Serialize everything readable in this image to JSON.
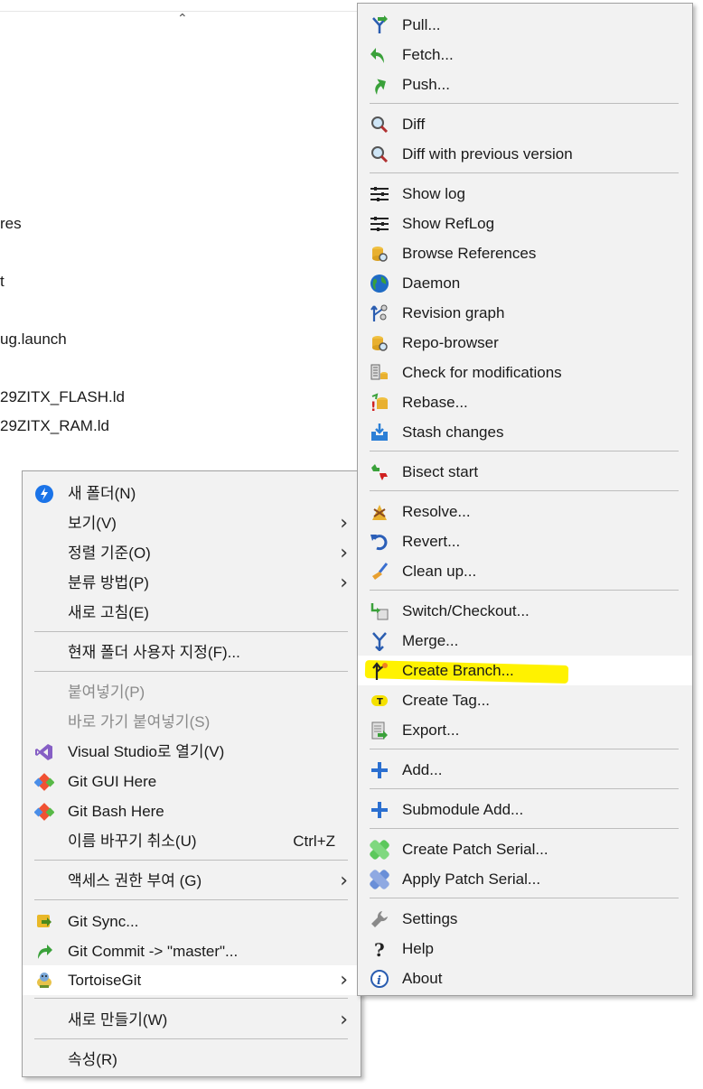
{
  "explorer": {
    "files": [
      "res",
      "t",
      "ug.launch",
      "29ZITX_FLASH.ld",
      "29ZITX_RAM.ld"
    ]
  },
  "left_menu": {
    "new_folder": "새 폴더(N)",
    "view": "보기(V)",
    "sort_by": "정렬 기준(O)",
    "group_by": "분류 방법(P)",
    "refresh": "새로 고침(E)",
    "customize_folder": "현재 폴더 사용자 지정(F)...",
    "paste": "붙여넣기(P)",
    "paste_shortcut": "바로 가기 붙여넣기(S)",
    "open_visual_studio": "Visual Studio로 열기(V)",
    "git_gui_here": "Git GUI Here",
    "git_bash_here": "Git Bash Here",
    "undo_rename": "이름 바꾸기 취소(U)",
    "undo_shortcut": "Ctrl+Z",
    "give_access": "액세스 권한 부여 (G)",
    "git_sync": "Git Sync...",
    "git_commit": "Git Commit -> \"master\"...",
    "tortoisegit": "TortoiseGit",
    "new": "새로 만들기(W)",
    "properties": "속성(R)"
  },
  "right_menu": {
    "pull": "Pull...",
    "fetch": "Fetch...",
    "push": "Push...",
    "diff": "Diff",
    "diff_prev": "Diff with previous version",
    "show_log": "Show log",
    "show_reflog": "Show RefLog",
    "browse_refs": "Browse References",
    "daemon": "Daemon",
    "revision_graph": "Revision graph",
    "repo_browser": "Repo-browser",
    "check_mods": "Check for modifications",
    "rebase": "Rebase...",
    "stash": "Stash changes",
    "bisect": "Bisect start",
    "resolve": "Resolve...",
    "revert": "Revert...",
    "cleanup": "Clean up...",
    "switch_checkout": "Switch/Checkout...",
    "merge": "Merge...",
    "create_branch": "Create Branch...",
    "create_tag": "Create Tag...",
    "export": "Export...",
    "add": "Add...",
    "submodule_add": "Submodule Add...",
    "create_patch": "Create Patch Serial...",
    "apply_patch": "Apply Patch Serial...",
    "settings": "Settings",
    "help": "Help",
    "about": "About"
  },
  "colors": {
    "menu_bg": "#f2f2f2",
    "hover_bg": "#ffffff",
    "highlight": "#fff200",
    "disabled_text": "#8a8a8a"
  }
}
